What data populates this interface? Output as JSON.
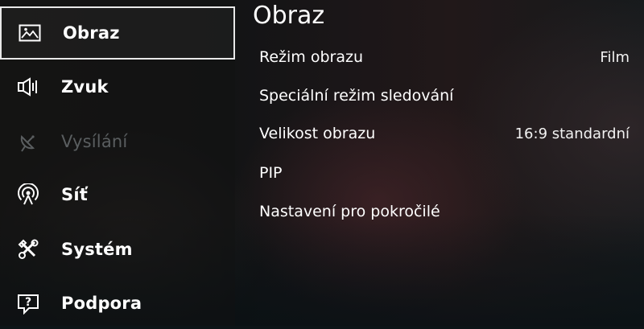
{
  "sidebar": {
    "items": [
      {
        "label": "Obraz",
        "icon": "picture-icon"
      },
      {
        "label": "Zvuk",
        "icon": "speaker-icon"
      },
      {
        "label": "Vysílání",
        "icon": "satellite-dish-icon"
      },
      {
        "label": "Síť",
        "icon": "network-signal-icon"
      },
      {
        "label": "Systém",
        "icon": "tools-icon"
      },
      {
        "label": "Podpora",
        "icon": "support-question-icon"
      }
    ]
  },
  "panel": {
    "title": "Obraz",
    "settings": [
      {
        "label": "Režim obrazu",
        "value": "Film"
      },
      {
        "label": "Speciální režim sledování",
        "value": ""
      },
      {
        "label": "Velikost obrazu",
        "value": "16:9 standardní"
      },
      {
        "label": "PIP",
        "value": ""
      },
      {
        "label": "Nastavení pro pokročilé",
        "value": ""
      }
    ]
  },
  "colors": {
    "text": "#ffffff",
    "disabled": "#5a5e60",
    "focus_border": "#e8e8e8"
  }
}
